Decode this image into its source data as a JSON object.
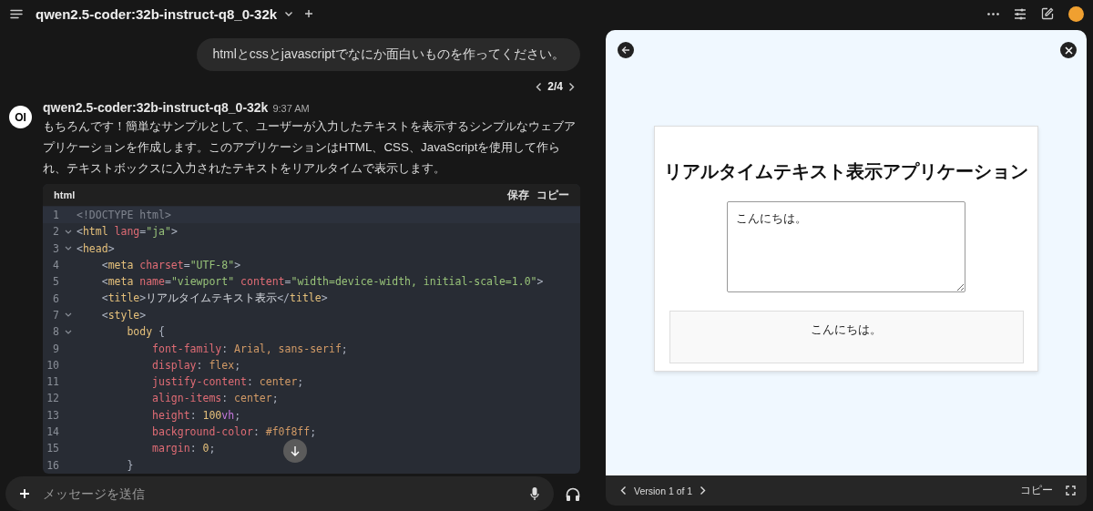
{
  "top_bar": {
    "model_name": "qwen2.5-coder:32b-instruct-q8_0-32k"
  },
  "user_message": {
    "text": "htmlとcssとjavascriptでなにか面白いものを作ってください。",
    "pager": "2/4"
  },
  "assistant_message": {
    "logo": "OI",
    "model_name": "qwen2.5-coder:32b-instruct-q8_0-32k",
    "time": "9:37 AM",
    "text": "もちろんです！簡単なサンプルとして、ユーザーが入力したテキストを表示するシンプルなウェブアプリケーションを作成します。このアプリケーションはHTML、CSS、JavaScriptを使用して作られ、テキストボックスに入力されたテキストをリアルタイムで表示します。"
  },
  "code_block": {
    "language": "html",
    "actions": [
      "保存",
      "コピー"
    ],
    "lines": [
      {
        "number": "1",
        "foldable": false,
        "active": true,
        "tokens": [
          {
            "kind": "doctype",
            "text": "<!DOCTYPE html>"
          }
        ]
      },
      {
        "number": "2",
        "foldable": true,
        "active": false,
        "tokens": [
          {
            "kind": "punct",
            "text": "<"
          },
          {
            "kind": "tag",
            "text": "html"
          },
          {
            "kind": "attr",
            "text": " lang"
          },
          {
            "kind": "punct",
            "text": "="
          },
          {
            "kind": "str",
            "text": "\"ja\""
          },
          {
            "kind": "punct",
            "text": ">"
          }
        ]
      },
      {
        "number": "3",
        "foldable": true,
        "active": false,
        "tokens": [
          {
            "kind": "punct",
            "text": "<"
          },
          {
            "kind": "tag",
            "text": "head"
          },
          {
            "kind": "punct",
            "text": ">"
          }
        ]
      },
      {
        "number": "4",
        "foldable": false,
        "active": false,
        "tokens": [
          {
            "kind": "punct",
            "text": "    <"
          },
          {
            "kind": "tag",
            "text": "meta"
          },
          {
            "kind": "attr",
            "text": " charset"
          },
          {
            "kind": "punct",
            "text": "="
          },
          {
            "kind": "str",
            "text": "\"UTF-8\""
          },
          {
            "kind": "punct",
            "text": ">"
          }
        ]
      },
      {
        "number": "5",
        "foldable": false,
        "active": false,
        "tokens": [
          {
            "kind": "punct",
            "text": "    <"
          },
          {
            "kind": "tag",
            "text": "meta"
          },
          {
            "kind": "attr",
            "text": " name"
          },
          {
            "kind": "punct",
            "text": "="
          },
          {
            "kind": "str",
            "text": "\"viewport\""
          },
          {
            "kind": "attr",
            "text": " content"
          },
          {
            "kind": "punct",
            "text": "="
          },
          {
            "kind": "str",
            "text": "\"width=device-width, initial-scale=1.0\""
          },
          {
            "kind": "punct",
            "text": ">"
          }
        ]
      },
      {
        "number": "6",
        "foldable": false,
        "active": false,
        "tokens": [
          {
            "kind": "punct",
            "text": "    <"
          },
          {
            "kind": "tag",
            "text": "title"
          },
          {
            "kind": "punct",
            "text": ">"
          },
          {
            "kind": "text",
            "text": "リアルタイムテキスト表示"
          },
          {
            "kind": "punct",
            "text": "</"
          },
          {
            "kind": "tag",
            "text": "title"
          },
          {
            "kind": "punct",
            "text": ">"
          }
        ]
      },
      {
        "number": "7",
        "foldable": true,
        "active": false,
        "tokens": [
          {
            "kind": "punct",
            "text": "    <"
          },
          {
            "kind": "tag",
            "text": "style"
          },
          {
            "kind": "punct",
            "text": ">"
          }
        ]
      },
      {
        "number": "8",
        "foldable": true,
        "active": false,
        "tokens": [
          {
            "kind": "tag",
            "text": "        body"
          },
          {
            "kind": "punct",
            "text": " {"
          }
        ]
      },
      {
        "number": "9",
        "foldable": false,
        "active": false,
        "tokens": [
          {
            "kind": "prop",
            "text": "            font-family"
          },
          {
            "kind": "punct",
            "text": ": "
          },
          {
            "kind": "val",
            "text": "Arial, sans-serif"
          },
          {
            "kind": "punct",
            "text": ";"
          }
        ]
      },
      {
        "number": "10",
        "foldable": false,
        "active": false,
        "tokens": [
          {
            "kind": "prop",
            "text": "            display"
          },
          {
            "kind": "punct",
            "text": ": "
          },
          {
            "kind": "val",
            "text": "flex"
          },
          {
            "kind": "punct",
            "text": ";"
          }
        ]
      },
      {
        "number": "11",
        "foldable": false,
        "active": false,
        "tokens": [
          {
            "kind": "prop",
            "text": "            justify-content"
          },
          {
            "kind": "punct",
            "text": ": "
          },
          {
            "kind": "val",
            "text": "center"
          },
          {
            "kind": "punct",
            "text": ";"
          }
        ]
      },
      {
        "number": "12",
        "foldable": false,
        "active": false,
        "tokens": [
          {
            "kind": "prop",
            "text": "            align-items"
          },
          {
            "kind": "punct",
            "text": ": "
          },
          {
            "kind": "val",
            "text": "center"
          },
          {
            "kind": "punct",
            "text": ";"
          }
        ]
      },
      {
        "number": "13",
        "foldable": false,
        "active": false,
        "tokens": [
          {
            "kind": "prop",
            "text": "            height"
          },
          {
            "kind": "punct",
            "text": ": "
          },
          {
            "kind": "num",
            "text": "100"
          },
          {
            "kind": "unit",
            "text": "vh"
          },
          {
            "kind": "punct",
            "text": ";"
          }
        ]
      },
      {
        "number": "14",
        "foldable": false,
        "active": false,
        "tokens": [
          {
            "kind": "prop",
            "text": "            background-color"
          },
          {
            "kind": "punct",
            "text": ": "
          },
          {
            "kind": "val",
            "text": "#f0f8ff"
          },
          {
            "kind": "punct",
            "text": ";"
          }
        ]
      },
      {
        "number": "15",
        "foldable": false,
        "active": false,
        "tokens": [
          {
            "kind": "prop",
            "text": "            margin"
          },
          {
            "kind": "punct",
            "text": ": "
          },
          {
            "kind": "num",
            "text": "0"
          },
          {
            "kind": "punct",
            "text": ";"
          }
        ]
      },
      {
        "number": "16",
        "foldable": false,
        "active": false,
        "tokens": [
          {
            "kind": "punct",
            "text": "        }"
          }
        ]
      }
    ]
  },
  "message_input": {
    "placeholder": "メッセージを送信"
  },
  "preview": {
    "heading": "リアルタイムテキスト表示アプリケーション",
    "textarea_value": "こんにちは。",
    "output": "こんにちは。",
    "version": "Version 1 of 1",
    "copy": "コピー"
  }
}
